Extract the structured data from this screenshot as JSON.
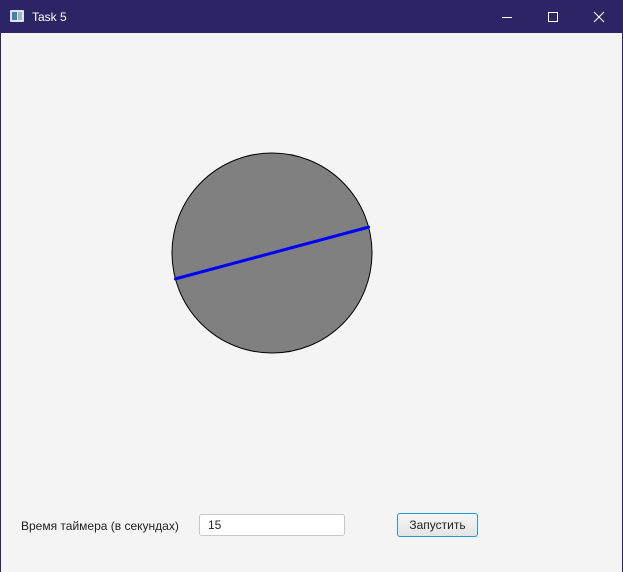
{
  "window": {
    "title": "Task 5",
    "titlebar_color": "#2b2566"
  },
  "caption_buttons": {
    "minimize_icon": "minimize-icon",
    "maximize_icon": "maximize-icon",
    "close_icon": "close-icon"
  },
  "canvas": {
    "circle_fill": "#808080",
    "circle_stroke": "#000000",
    "line_color": "#0000ff",
    "line_angle_degrees": 15
  },
  "form": {
    "timer_label": "Время таймера (в секундах)",
    "timer_value": "15",
    "start_button_label": "Запустить",
    "button_border_color": "#2a98d6"
  }
}
